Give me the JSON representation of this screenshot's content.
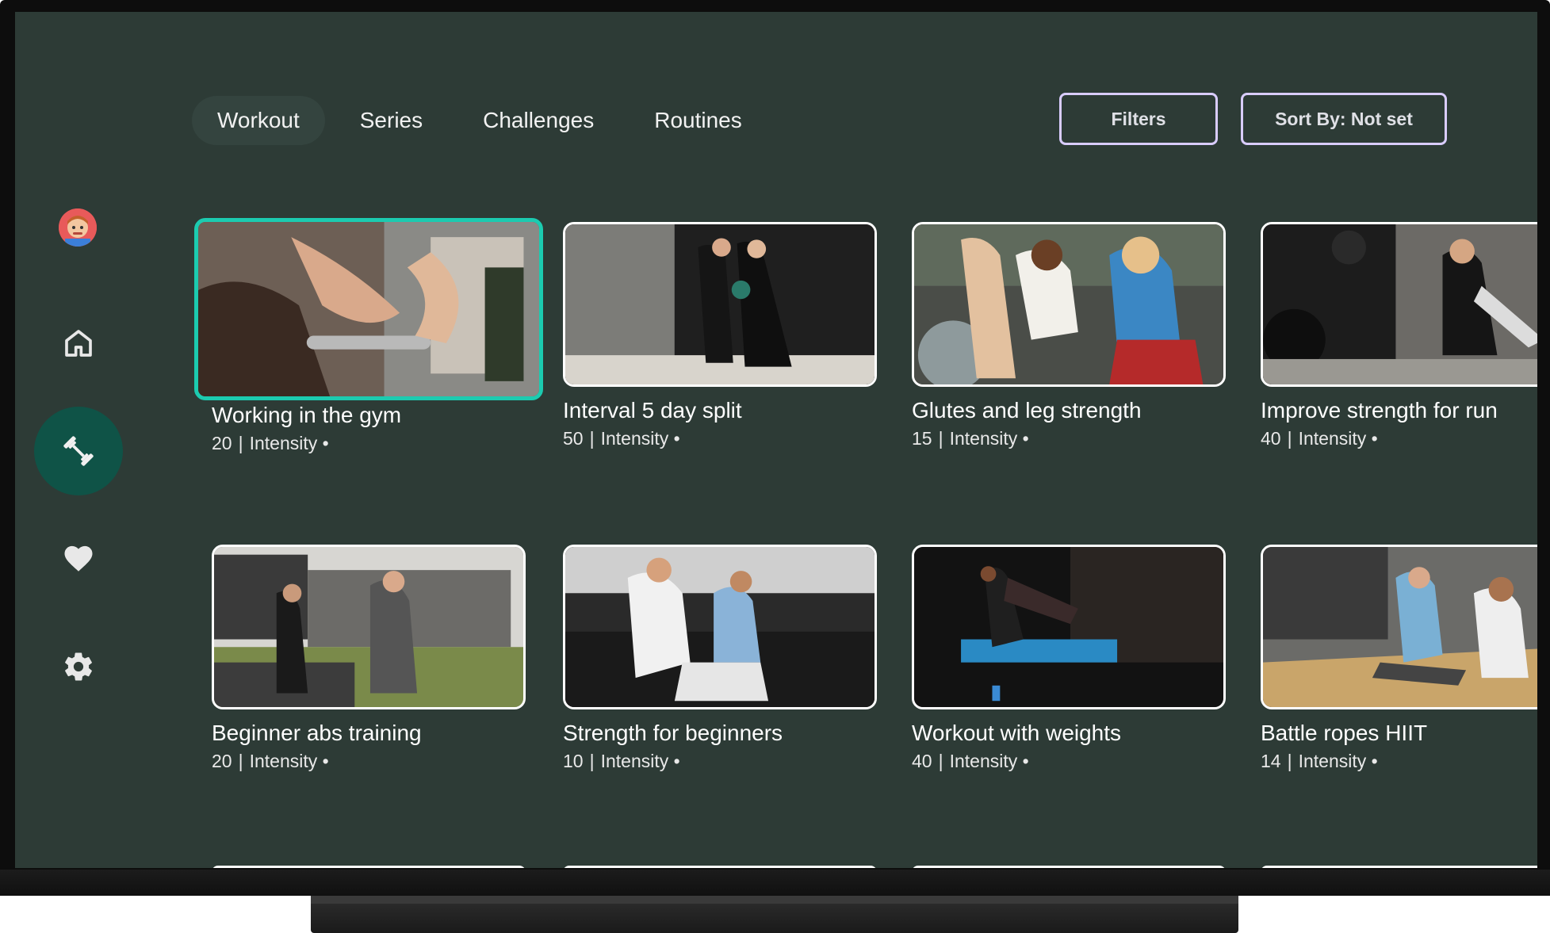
{
  "tabs": [
    {
      "label": "Workout",
      "active": true
    },
    {
      "label": "Series",
      "active": false
    },
    {
      "label": "Challenges",
      "active": false
    },
    {
      "label": "Routines",
      "active": false
    }
  ],
  "actions": {
    "filters_label": "Filters",
    "sort_label": "Sort By: Not set"
  },
  "sidebar": {
    "items": [
      "avatar",
      "home-icon",
      "dumbbell-icon",
      "heart-icon",
      "gear-icon"
    ],
    "active": "dumbbell-icon"
  },
  "cards": [
    {
      "title": "Working in the gym",
      "count": "20",
      "intensity": "Intensity •",
      "focused": true
    },
    {
      "title": "Interval 5 day split",
      "count": "50",
      "intensity": "Intensity •"
    },
    {
      "title": "Glutes and leg strength",
      "count": "15",
      "intensity": "Intensity •"
    },
    {
      "title": "Improve strength for run",
      "count": "40",
      "intensity": "Intensity •"
    },
    {
      "title": "Beginner abs training",
      "count": "20",
      "intensity": "Intensity •"
    },
    {
      "title": "Strength for beginners",
      "count": "10",
      "intensity": "Intensity •"
    },
    {
      "title": "Workout with weights",
      "count": "40",
      "intensity": "Intensity •"
    },
    {
      "title": "Battle ropes HIIT",
      "count": "14",
      "intensity": "Intensity •"
    }
  ],
  "colors": {
    "screen_bg": "#2d3b36",
    "focus_ring": "#1ccbb0",
    "active_nav": "#0f5347",
    "button_border": "#d9ccff"
  }
}
